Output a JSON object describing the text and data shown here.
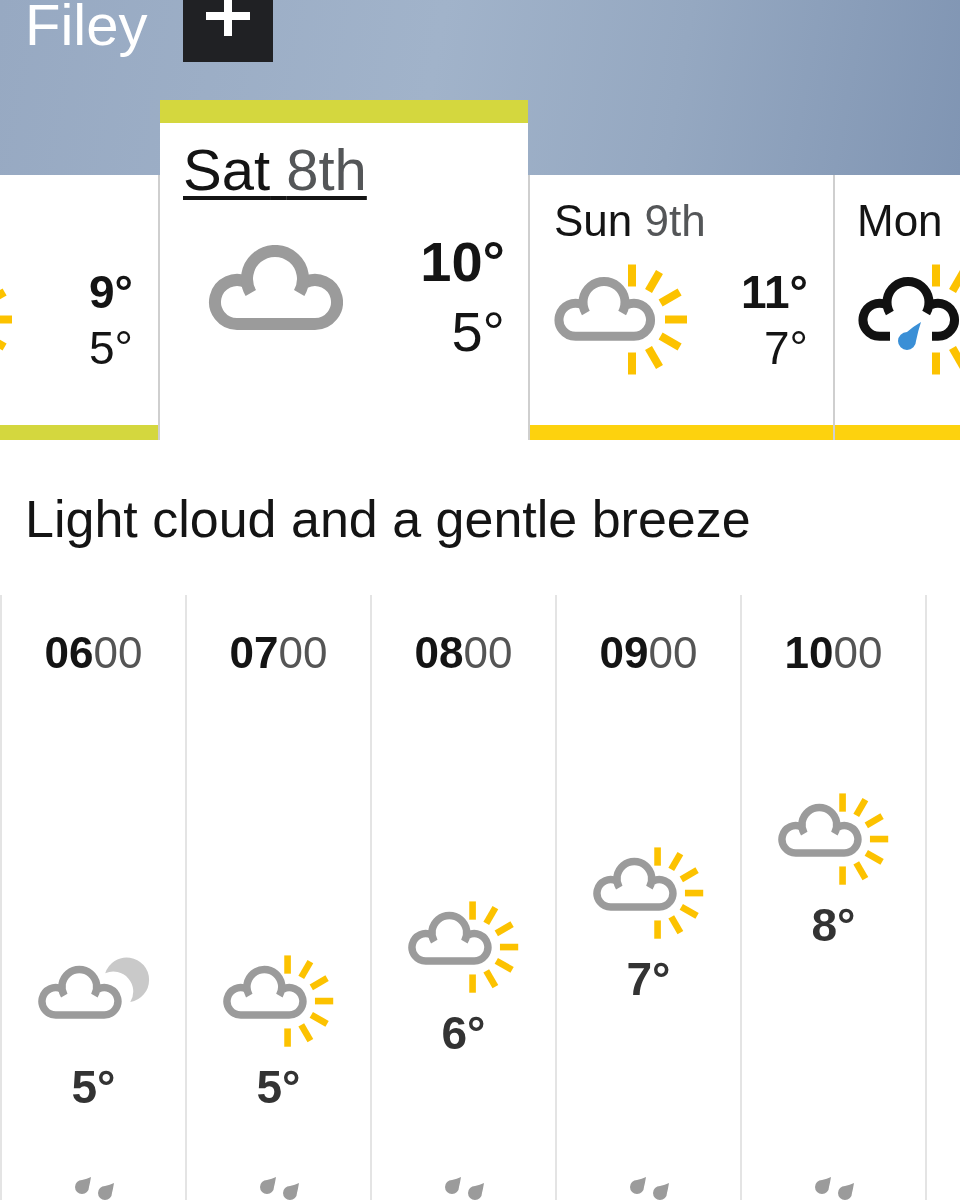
{
  "location": {
    "name": "Filey"
  },
  "days": [
    {
      "selected": false,
      "kind": "sunny-intervals",
      "high": "9°",
      "low": "5°",
      "color": "#d4d73e"
    },
    {
      "selected": true,
      "day": "Sat",
      "date": "8th",
      "kind": "light-cloud",
      "high": "10°",
      "low": "5°",
      "color": "#d4d73e"
    },
    {
      "selected": false,
      "day": "Sun",
      "date": "9th",
      "kind": "sunny-intervals",
      "high": "11°",
      "low": "7°",
      "color": "#fdd20e"
    },
    {
      "selected": false,
      "day": "Mon",
      "kind": "light-rain-sunny",
      "color": "#fdd20e"
    }
  ],
  "summary": "Light cloud and a gentle breeze",
  "hours": [
    {
      "hour": "06",
      "minutes": "00",
      "kind": "partly-cloudy-night",
      "temperature": "5°"
    },
    {
      "hour": "07",
      "minutes": "00",
      "kind": "sunny-intervals",
      "temperature": "5°"
    },
    {
      "hour": "08",
      "minutes": "00",
      "kind": "sunny-intervals",
      "temperature": "6°"
    },
    {
      "hour": "09",
      "minutes": "00",
      "kind": "sunny-intervals",
      "temperature": "7°"
    },
    {
      "hour": "10",
      "minutes": "00",
      "kind": "sunny-intervals",
      "temperature": "8°"
    }
  ]
}
